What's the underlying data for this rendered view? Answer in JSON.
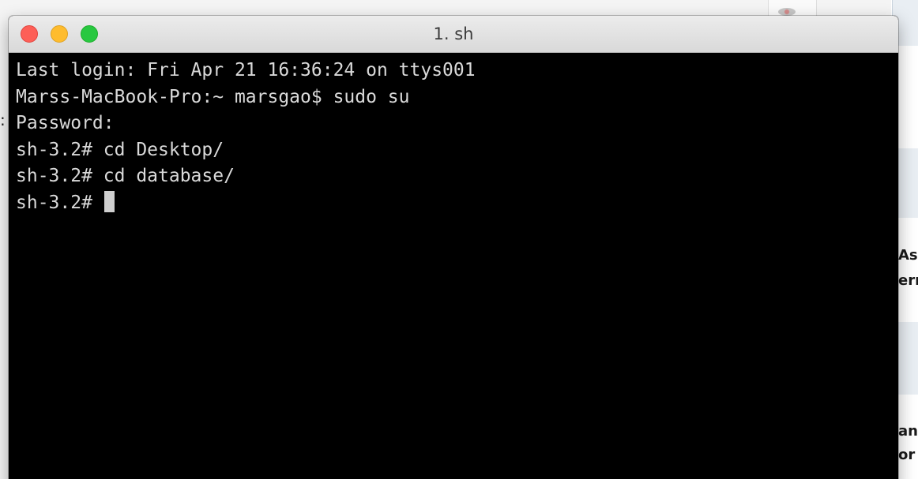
{
  "window": {
    "title": "1. sh",
    "buttons": {
      "close": "close",
      "minimize": "minimize",
      "zoom": "zoom"
    }
  },
  "terminal": {
    "lines": [
      "Last login: Fri Apr 21 16:36:24 on ttys001",
      "Marss-MacBook-Pro:~ marsgao$ sudo su",
      "Password:",
      "sh-3.2# cd Desktop/",
      "sh-3.2# cd database/"
    ],
    "prompt": "sh-3.2# "
  },
  "backdrop": {
    "fragments": [
      "As",
      "err",
      "an",
      "or"
    ]
  },
  "colors": {
    "close": "#fd5f57",
    "minimize": "#febc2e",
    "zoom": "#28c840",
    "terminal_bg": "#000000",
    "terminal_fg": "#d9d9d9"
  }
}
